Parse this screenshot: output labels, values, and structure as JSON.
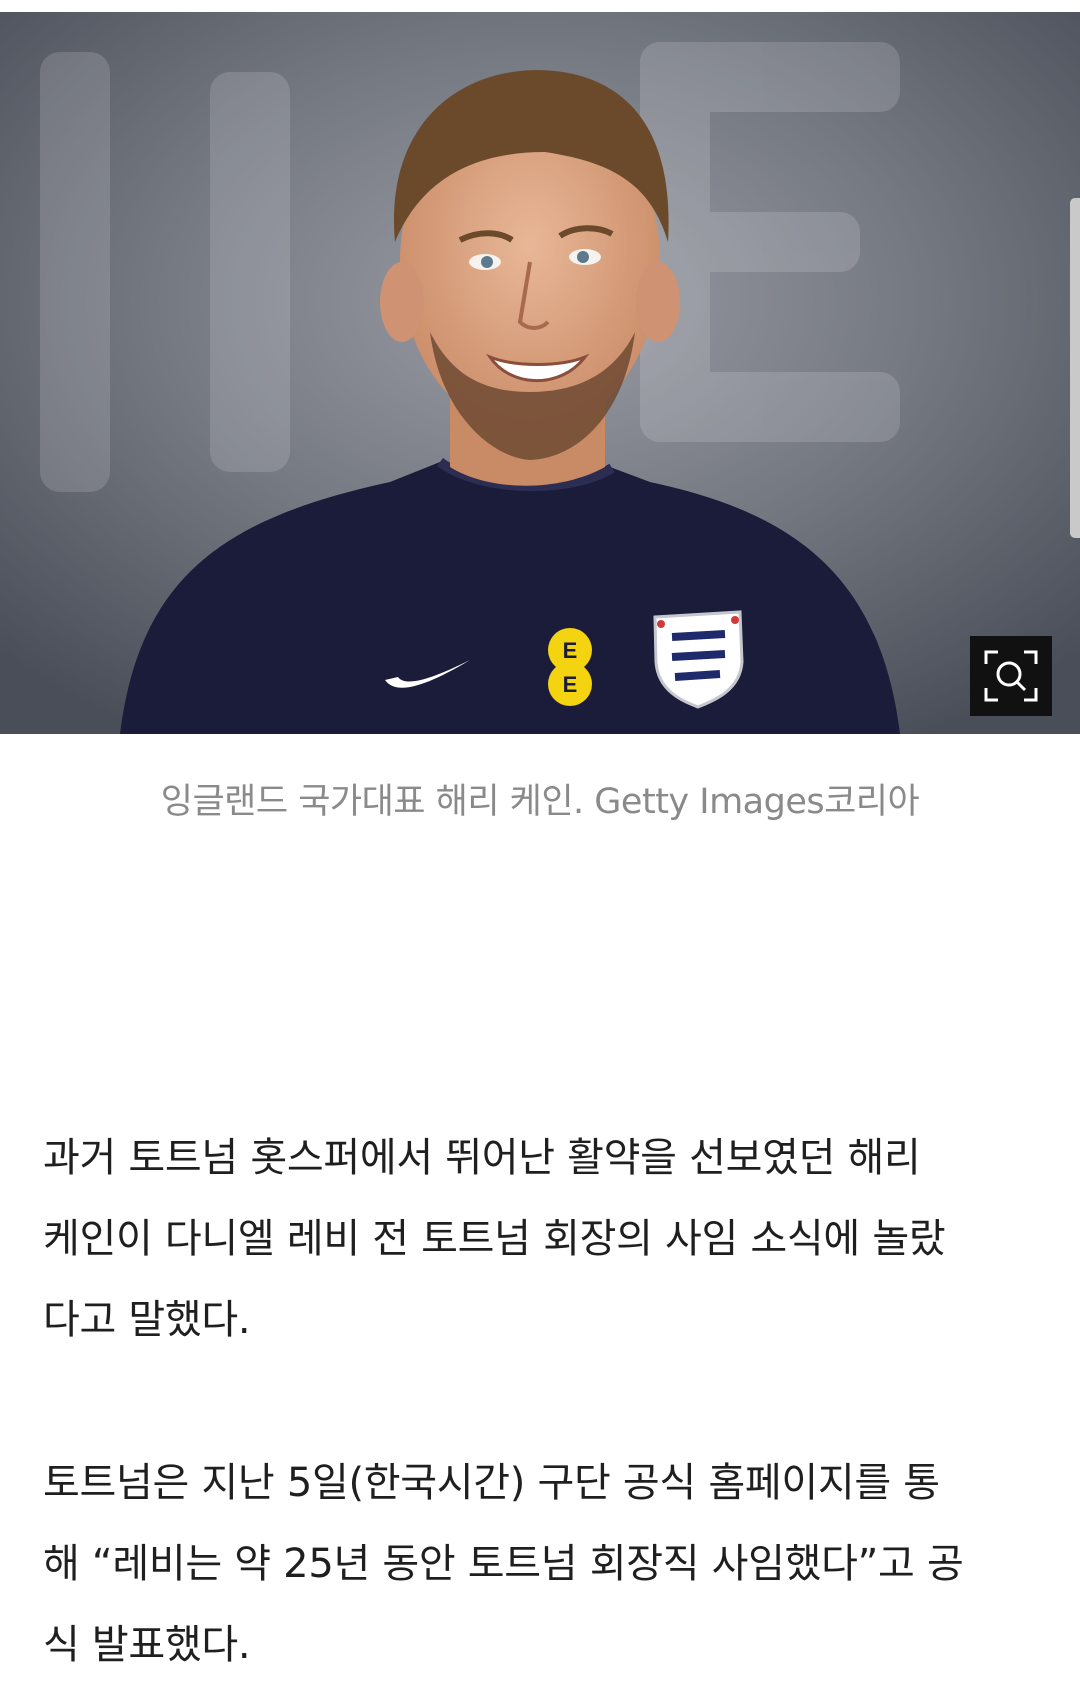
{
  "photo": {
    "alt_subject": "photo",
    "sponsor_badge_letters": [
      "E",
      "E"
    ]
  },
  "zoom_button": {
    "icon": "zoom-search-icon"
  },
  "caption": {
    "text": "잉글랜드 국가대표 해리 케인. Getty Images코리아"
  },
  "article": {
    "paragraphs": [
      {
        "lines": [
          "과거 토트넘 홋스퍼에서 뛰어난 활약을 선보였던 해리",
          "케인이 다니엘 레비 전 토트넘 회장의 사임 소식에 놀랐",
          "다고 말했다."
        ]
      },
      {
        "lines": [
          "토트넘은 지난 5일(한국시간) 구단 공식 홈페이지를 통",
          "해 “레비는 약 25년 동안 토트넘 회장직 사임했다”고 공",
          "식 발표했다."
        ]
      }
    ]
  },
  "colors": {
    "caption_text": "#8a8a8a",
    "body_text": "#1f1f1f",
    "shirt_navy": "#1b1c3a",
    "badge_yellow": "#f4d410"
  }
}
